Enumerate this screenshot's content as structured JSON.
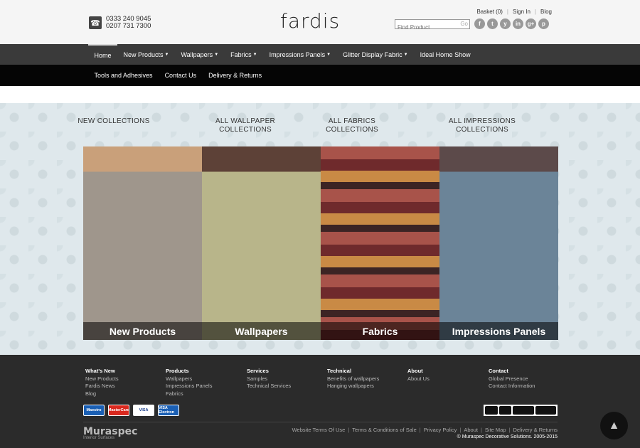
{
  "header": {
    "phone_1": "0333 240 9045",
    "phone_2": "0207 731 7300",
    "logo": "fardis",
    "basket": "Basket (0)",
    "sign_in": "Sign In",
    "blog": "Blog",
    "search_placeholder": "Find Product",
    "search_go": "Go",
    "socials": [
      "f",
      "t",
      "y",
      "in",
      "g+",
      "p"
    ]
  },
  "nav": {
    "row1": [
      "Home",
      "New Products",
      "Wallpapers",
      "Fabrics",
      "Impressions Panels",
      "Glitter Display Fabric",
      "Ideal Home Show"
    ],
    "row2": [
      "Tools and Adhesives",
      "Contact Us",
      "Delivery & Returns"
    ]
  },
  "categories": {
    "labels": [
      "NEW COLLECTIONS",
      "All WALLPAPER COLLECTIONS",
      "All FABRICS COLLECTIONS",
      "All IMPRESSIONS COLLECTIONS"
    ],
    "tiles": [
      "New Products",
      "Wallpapers",
      "Fabrics",
      "Impressions Panels"
    ]
  },
  "footer": {
    "columns": [
      {
        "heading": "What's New",
        "links": [
          "New Products",
          "Fardis News",
          "Blog"
        ]
      },
      {
        "heading": "Products",
        "links": [
          "Wallpapers",
          "Impressions Panels",
          "Fabrics"
        ]
      },
      {
        "heading": "Services",
        "links": [
          "Samples",
          "Technical Services"
        ]
      },
      {
        "heading": "Technical",
        "links": [
          "Benefits of wallpapers",
          "Hanging wallpapers"
        ]
      },
      {
        "heading": "About",
        "links": [
          "About Us"
        ]
      },
      {
        "heading": "Contact",
        "links": [
          "Global Presence",
          "Contact Information"
        ]
      }
    ],
    "cards": [
      "Maestro",
      "MasterCard",
      "VISA",
      "VISA Electron"
    ],
    "brand": "Muraspec",
    "brand_sub": "Interior Surfaces",
    "legal_links": [
      "Website Terms Of Use",
      "Terms & Conditions of Sale",
      "Privacy Policy",
      "About",
      "Site Map",
      "Delivery & Returns"
    ],
    "copyright": "© Muraspec Decorative Solutions. 2005-2015"
  }
}
